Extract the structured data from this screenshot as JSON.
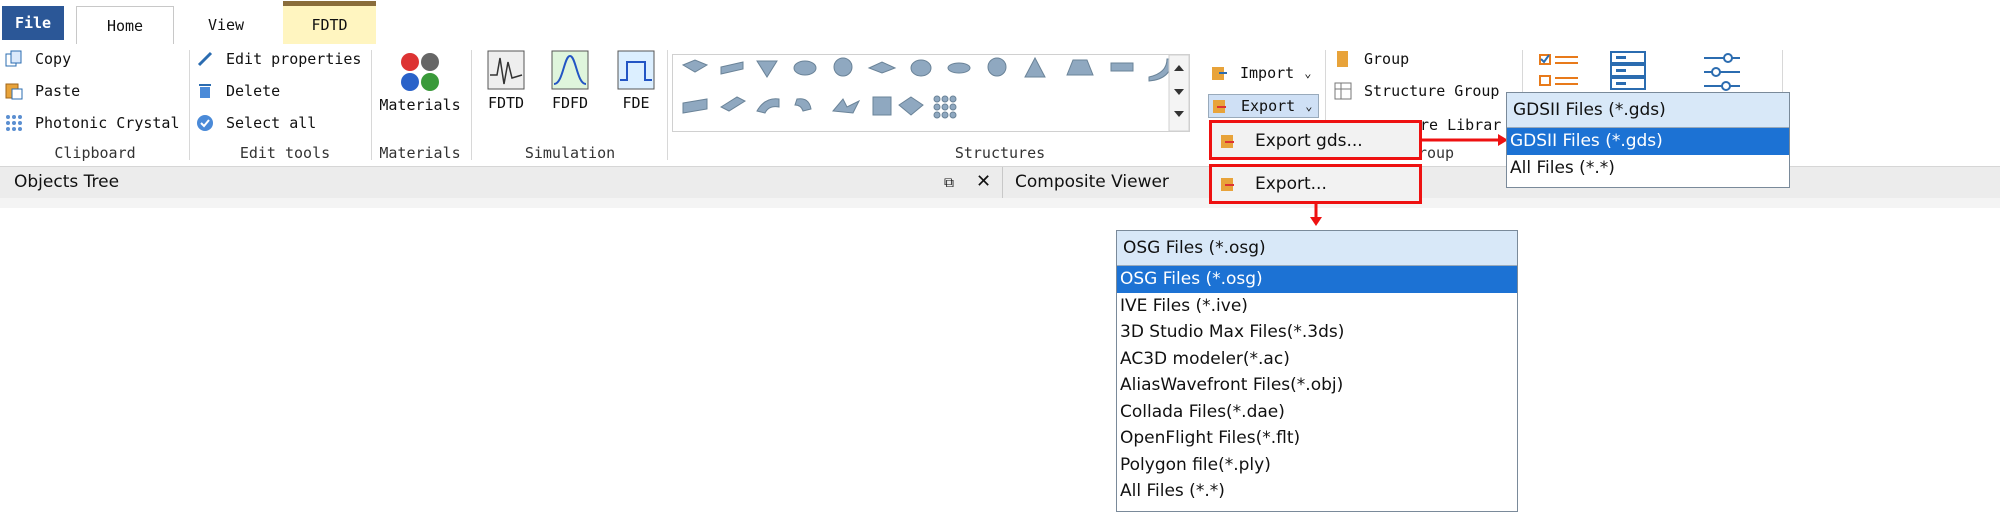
{
  "tabs": {
    "file": "File",
    "home": "Home",
    "view": "View",
    "fdtd": "FDTD"
  },
  "clipboard": {
    "copy": "Copy",
    "paste": "Paste",
    "photonic_crystal": "Photonic Crystal",
    "label": "Clipboard"
  },
  "edit_tools": {
    "edit_properties": "Edit properties",
    "delete": "Delete",
    "select_all": "Select all",
    "label": "Edit tools"
  },
  "materials": {
    "button": "Materials",
    "label": "Materials"
  },
  "simulation": {
    "fdtd": "FDTD",
    "fdfd": "FDFD",
    "fde": "FDE",
    "label": "Simulation"
  },
  "structures": {
    "label": "Structures"
  },
  "import_export": {
    "import": "Import",
    "export": "Export"
  },
  "group": {
    "group": "Group",
    "structure_group": "Structure Group",
    "library_partial": "re Librar",
    "label_partial": "roup"
  },
  "panels": {
    "objects_tree": "Objects Tree",
    "composite_viewer": "Composite Viewer"
  },
  "export_menu": {
    "export_gds": "Export gds...",
    "export": "Export..."
  },
  "gds_dropdown": {
    "header": "GDSII Files (*.gds)",
    "options": [
      "GDSII Files (*.gds)",
      "All Files (*.*)"
    ],
    "selected_index": 0
  },
  "osg_dropdown": {
    "header": "OSG Files (*.osg)",
    "options": [
      "OSG Files (*.osg)",
      "IVE Files (*.ive)",
      "3D Studio Max Files(*.3ds)",
      "AC3D modeler(*.ac)",
      "AliasWavefront Files(*.obj)",
      "Collada Files(*.dae)",
      "OpenFlight Files(*.flt)",
      "Polygon file(*.ply)",
      "All Files (*.*)"
    ],
    "selected_index": 0
  },
  "colors": {
    "file_tab": "#2b5797",
    "selection": "#1c72d4",
    "highlight_red": "#e11111",
    "fdtd_tab": "#fff5c0"
  }
}
